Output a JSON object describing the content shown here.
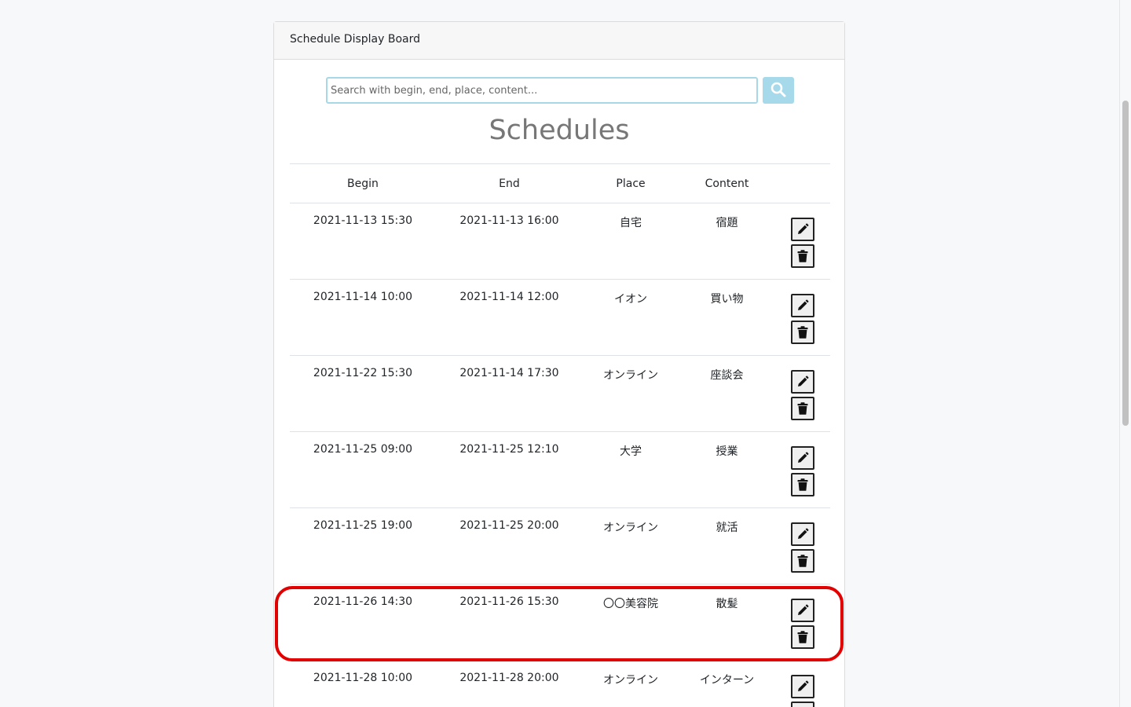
{
  "header": {
    "title": "Schedule Display Board"
  },
  "search": {
    "placeholder": "Search with begin, end, place, content...",
    "value": ""
  },
  "page_title": "Schedules",
  "table": {
    "columns": [
      "Begin",
      "End",
      "Place",
      "Content",
      ""
    ],
    "rows": [
      {
        "begin": "2021-11-13 15:30",
        "end": "2021-11-13 16:00",
        "place": "自宅",
        "content": "宿題"
      },
      {
        "begin": "2021-11-14 10:00",
        "end": "2021-11-14 12:00",
        "place": "イオン",
        "content": "買い物"
      },
      {
        "begin": "2021-11-22 15:30",
        "end": "2021-11-14 17:30",
        "place": "オンライン",
        "content": "座談会"
      },
      {
        "begin": "2021-11-25 09:00",
        "end": "2021-11-25 12:10",
        "place": "大学",
        "content": "授業"
      },
      {
        "begin": "2021-11-25 19:00",
        "end": "2021-11-25 20:00",
        "place": "オンライン",
        "content": "就活"
      },
      {
        "begin": "2021-11-26 14:30",
        "end": "2021-11-26 15:30",
        "place": "〇〇美容院",
        "content": "散髪"
      },
      {
        "begin": "2021-11-28 10:00",
        "end": "2021-11-28 20:00",
        "place": "オンライン",
        "content": "インターン"
      }
    ]
  },
  "icons": {
    "search": "search-icon",
    "edit": "pencil-icon",
    "delete": "trash-icon"
  },
  "colors": {
    "search_button": "#a6d9e9",
    "search_border": "#a7d8e8",
    "highlight": "#e30000"
  }
}
